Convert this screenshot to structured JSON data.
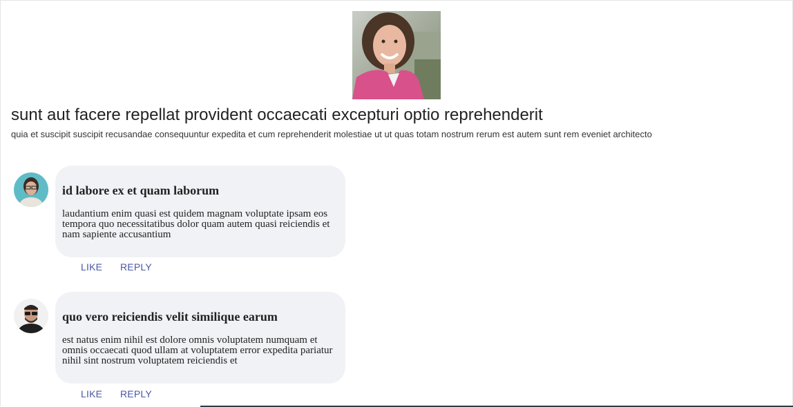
{
  "post": {
    "title": "sunt aut facere repellat provident occaecati excepturi optio reprehenderit",
    "body": "quia et suscipit suscipit recusandae consequuntur expedita et cum reprehenderit molestiae ut ut quas totam nostrum rerum est autem sunt rem eveniet architecto"
  },
  "comments": [
    {
      "title": "id labore ex et quam laborum",
      "body": "laudantium enim quasi est quidem magnam voluptate ipsam eos tempora quo necessitatibus dolor quam autem quasi reiciendis et nam sapiente accusantium",
      "like_label": "LIKE",
      "reply_label": "REPLY"
    },
    {
      "title": "quo vero reiciendis velit similique earum",
      "body": "est natus enim nihil est dolore omnis voluptatem numquam et omnis occaecati quod ullam at voluptatem error expedita pariatur nihil sint nostrum voluptatem reiciendis et",
      "like_label": "LIKE",
      "reply_label": "REPLY"
    }
  ],
  "colors": {
    "action_link": "#4a56a6",
    "bubble_bg": "#f0f2f5"
  }
}
